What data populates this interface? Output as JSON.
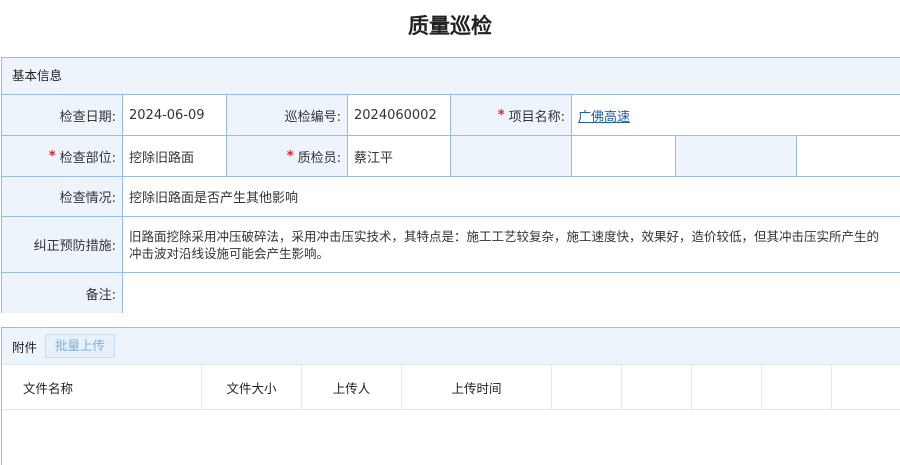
{
  "page": {
    "title": "质量巡检"
  },
  "basic_info": {
    "header": "基本信息",
    "fields": {
      "check_date": {
        "label": "检查日期:",
        "value": "2024-06-09"
      },
      "patrol_no": {
        "label": "巡检编号:",
        "value": "2024060002"
      },
      "project_name": {
        "label": "项目名称:",
        "value": "广佛高速",
        "required": true
      },
      "check_part": {
        "label": "检查部位:",
        "value": "挖除旧路面",
        "required": true
      },
      "inspector": {
        "label": "质检员:",
        "value": "蔡江平",
        "required": true
      },
      "situation": {
        "label": "检查情况:",
        "value": "挖除旧路面是否产生其他影响"
      },
      "measures": {
        "label": "纠正预防措施:",
        "value": "旧路面挖除采用冲压破碎法，采用冲击压实技术，其特点是：施工工艺较复杂，施工速度快，效果好，造价较低，但其冲击压实所产生的冲击波对沿线设施可能会产生影响。"
      },
      "remarks": {
        "label": "备注:",
        "value": ""
      }
    },
    "required_mark": "*"
  },
  "attachments": {
    "title": "附件",
    "upload_button": "批量上传",
    "columns": [
      "文件名称",
      "文件大小",
      "上传人",
      "上传时间"
    ]
  }
}
